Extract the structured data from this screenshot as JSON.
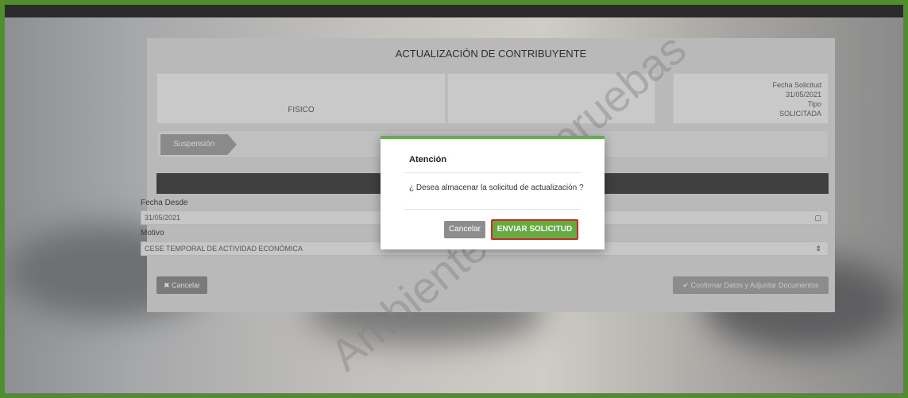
{
  "card": {
    "title": "ACTUALIZACIÓN DE CONTRIBUYENTE",
    "tipo_persona": "FISICO",
    "fecha_solicitud_label": "Fecha Solicitud",
    "fecha_solicitud_value": "31/05/2021",
    "tipo_label": "Tipo",
    "tipo_value": "SOLICITADA"
  },
  "step": {
    "label": "Suspensión"
  },
  "form": {
    "fecha_desde_label": "Fecha Desde",
    "fecha_desde_value": "31/05/2021",
    "motivo_label": "Motivo",
    "motivo_value": "CESE TEMPORAL DE ACTIVIDAD ECONÓMICA"
  },
  "actions": {
    "cancel_label": "✖ Cancelar",
    "confirm_label": "✔ Confirmar Datos y Adjuntar Documentos"
  },
  "watermark": {
    "word1": "Ambiente",
    "word2": "pruebas"
  },
  "modal": {
    "title": "Atención",
    "message": "¿ Desea almacenar la solicitud de actualización ?",
    "cancel_label": "Cancelar",
    "send_label": "ENVIAR SOLICITUD"
  },
  "colors": {
    "frame_border": "#4e8f2c",
    "modal_accent": "#61b04a",
    "send_button": "#62ad3e",
    "highlight_outline": "#d9232e"
  },
  "icons": {
    "calendar": "calendar-icon",
    "select_arrows": "select-arrows-icon"
  }
}
